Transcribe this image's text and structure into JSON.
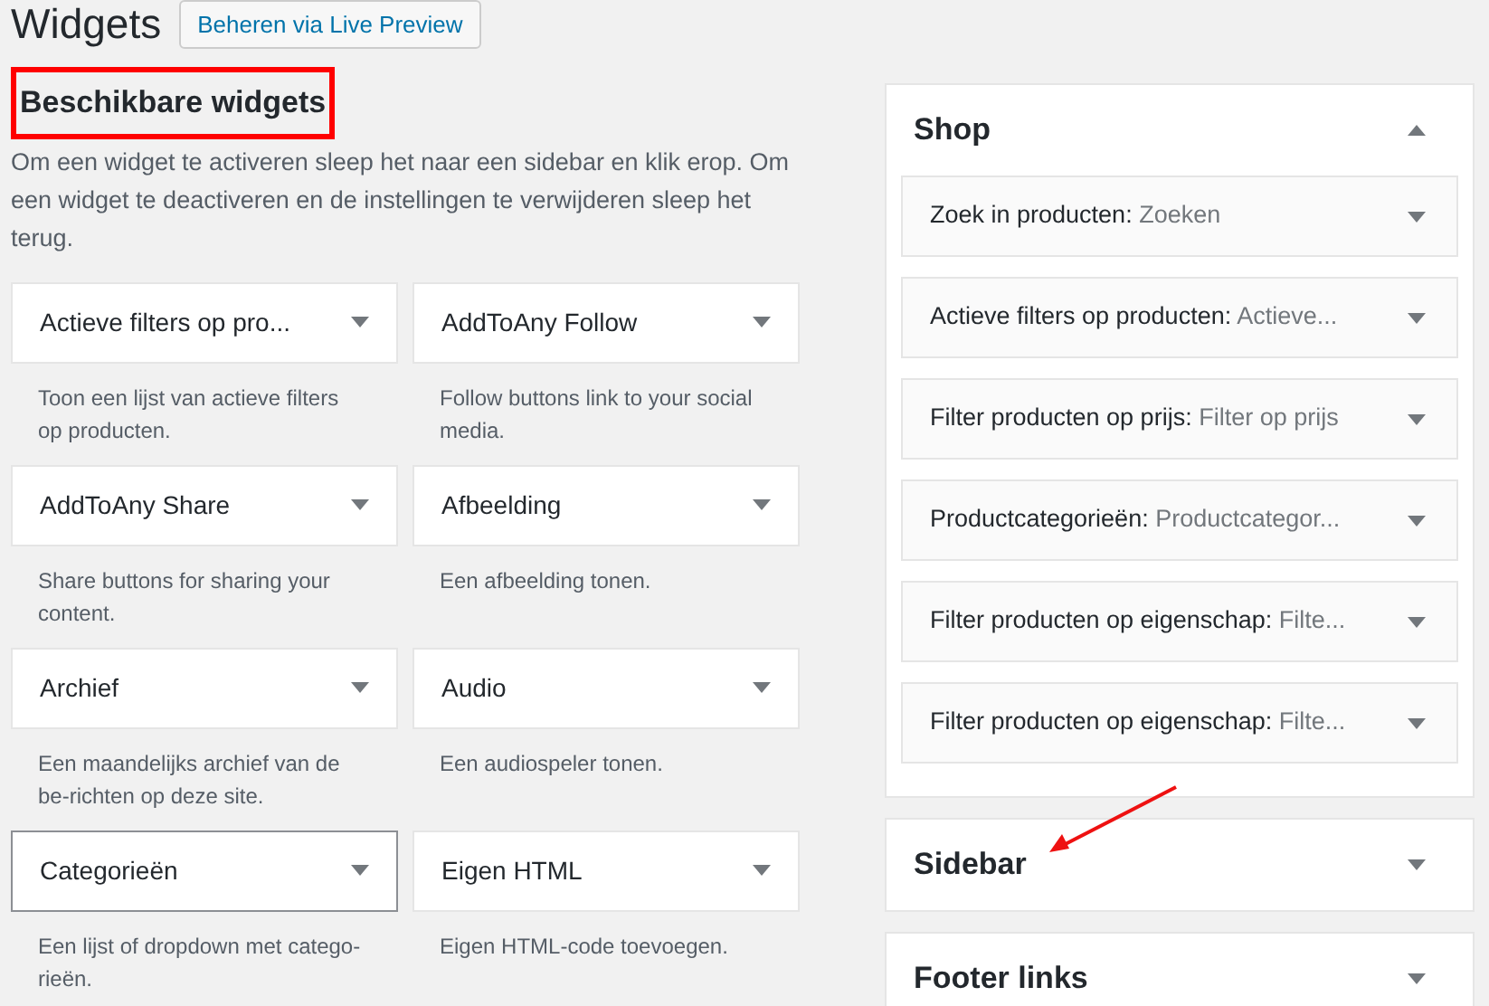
{
  "page": {
    "title": "Widgets",
    "action_button": "Beheren via Live Preview"
  },
  "available": {
    "heading": "Beschikbare widgets",
    "heading_outlined": true,
    "description": "Om een widget te activeren sleep het naar een sidebar en klik erop. Om een widget te deactiveren en de instellingen te verwijderen sleep het terug.",
    "widgets": [
      {
        "name": "Actieve filters op pro...",
        "description": "Toon een lijst van actieve filters op producten.",
        "focused": false
      },
      {
        "name": "AddToAny Follow",
        "description": "Follow buttons link to your social media.",
        "focused": false
      },
      {
        "name": "AddToAny Share",
        "description": "Share buttons for sharing your content.",
        "focused": false
      },
      {
        "name": "Afbeelding",
        "description": "Een afbeelding tonen.",
        "focused": false
      },
      {
        "name": "Archief",
        "description": "Een maandelijks archief van de be-richten op deze site.",
        "focused": false
      },
      {
        "name": "Audio",
        "description": "Een audiospeler tonen.",
        "focused": false
      },
      {
        "name": "Categorieën",
        "description": "Een lijst of dropdown met catego-rieën.",
        "focused": true
      },
      {
        "name": "Eigen HTML",
        "description": "Eigen HTML-code toevoegen.",
        "focused": false
      }
    ]
  },
  "sidebars": [
    {
      "name": "Shop",
      "expanded": true,
      "arrow_pointing": false,
      "widgets": [
        {
          "name": "Zoek in producten:",
          "title": "Zoeken"
        },
        {
          "name": "Actieve filters op producten:",
          "title": "Actieve..."
        },
        {
          "name": "Filter producten op prijs:",
          "title": "Filter op prijs"
        },
        {
          "name": "Productcategorieën:",
          "title": "Productcategor..."
        },
        {
          "name": "Filter producten op eigenschap:",
          "title": "Filte..."
        },
        {
          "name": "Filter producten op eigenschap:",
          "title": "Filte..."
        }
      ]
    },
    {
      "name": "Sidebar",
      "expanded": false,
      "arrow_pointing": true
    },
    {
      "name": "Footer links",
      "expanded": false,
      "arrow_pointing": false
    }
  ]
}
